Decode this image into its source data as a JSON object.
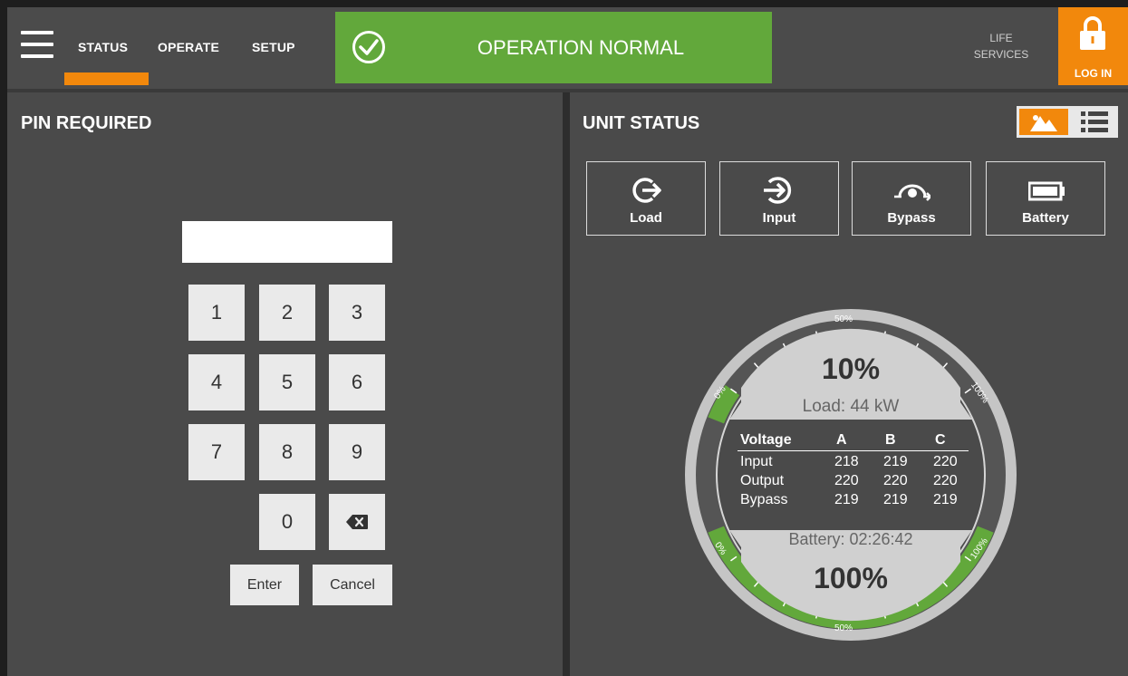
{
  "nav": {
    "tabs": [
      {
        "label": "STATUS",
        "active": true
      },
      {
        "label": "OPERATE",
        "active": false
      },
      {
        "label": "SETUP",
        "active": false
      }
    ],
    "accent": "#f2880c"
  },
  "status_banner": {
    "text": "OPERATION NORMAL",
    "color": "#62a83b",
    "icon": "check-circle-icon"
  },
  "life_services": {
    "line1": "LIFE",
    "line2": "SERVICES"
  },
  "login": {
    "label": "LOG IN",
    "icon": "lock-icon"
  },
  "pin_panel": {
    "title": "PIN REQUIRED",
    "input_value": "",
    "keys": [
      "1",
      "2",
      "3",
      "4",
      "5",
      "6",
      "7",
      "8",
      "9",
      "0"
    ],
    "backspace_icon": "backspace-icon",
    "enter_label": "Enter",
    "cancel_label": "Cancel"
  },
  "unit_panel": {
    "title": "UNIT STATUS",
    "view_toggle": {
      "graphic_icon": "diagram-view-icon",
      "list_icon": "list-view-icon",
      "selected": "graphic"
    },
    "buttons": [
      {
        "label": "Load",
        "icon": "load-icon"
      },
      {
        "label": "Input",
        "icon": "input-icon"
      },
      {
        "label": "Bypass",
        "icon": "bypass-icon"
      },
      {
        "label": "Battery",
        "icon": "battery-icon"
      }
    ],
    "gauge": {
      "load_percent": "10%",
      "load_fraction": 0.1,
      "load_text": "Load: 44 kW",
      "battery_text": "Battery: 02:26:42",
      "battery_percent": "100%",
      "battery_fraction": 1.0,
      "scale_labels": {
        "zero": "0%",
        "mid": "50%",
        "full": "100%"
      },
      "voltage_table": {
        "headers": [
          "Voltage",
          "A",
          "B",
          "C"
        ],
        "rows": [
          {
            "label": "Input",
            "values": [
              "218",
              "219",
              "220"
            ]
          },
          {
            "label": "Output",
            "values": [
              "220",
              "220",
              "220"
            ]
          },
          {
            "label": "Bypass",
            "values": [
              "219",
              "219",
              "219"
            ]
          }
        ]
      }
    }
  }
}
